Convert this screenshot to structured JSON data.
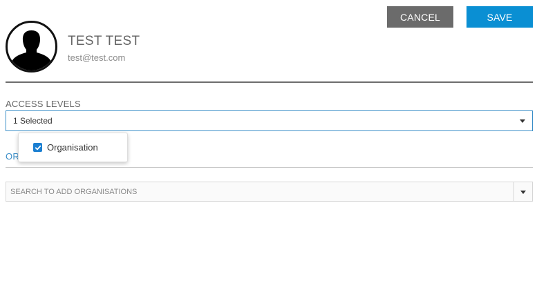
{
  "toolbar": {
    "cancel_label": "CANCEL",
    "save_label": "SAVE"
  },
  "profile": {
    "avatar_icon": "user-silhouette-icon",
    "name": "TEST TEST",
    "email": "test@test.com"
  },
  "access_levels": {
    "label": "ACCESS LEVELS",
    "selected_text": "1 Selected",
    "options": [
      {
        "label": "Organisation",
        "checked": true
      }
    ]
  },
  "organisations": {
    "heading": "OR",
    "search_placeholder": "SEARCH TO ADD ORGANISATIONS"
  },
  "colors": {
    "primary": "#0a8fd3",
    "secondary": "#6b6b6b",
    "accent_border": "#3a8ec8",
    "checkbox": "#1b7fd1"
  }
}
